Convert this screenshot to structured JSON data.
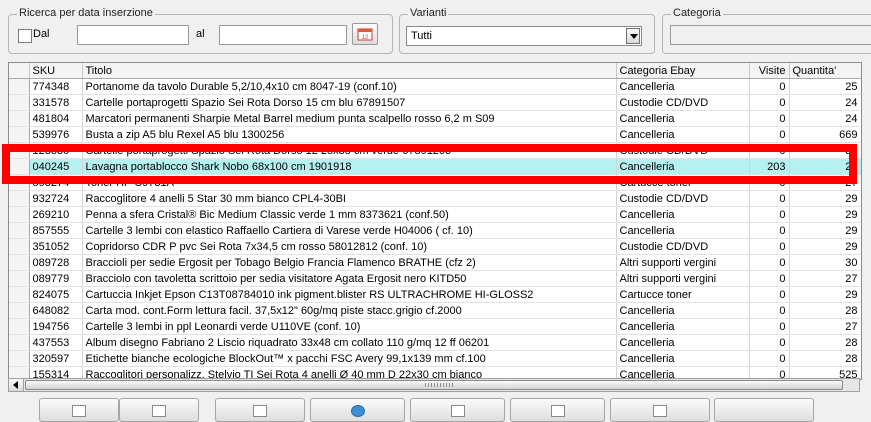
{
  "filters": {
    "date_group": {
      "title": "Ricerca per data inserzione",
      "from_label": "Dal",
      "from_value": "",
      "to_label": "al",
      "to_value": "",
      "calendar_icon": "calendar-icon"
    },
    "variants_group": {
      "title": "Varianti",
      "selected": "Tutti"
    },
    "category_group": {
      "title": "Categoria",
      "value": ""
    }
  },
  "table": {
    "columns": [
      "SKU",
      "Titolo",
      "Categoria Ebay",
      "Visite",
      "Quantita'"
    ],
    "rows": [
      {
        "sku": "774348",
        "title": "Portanome da tavolo Durable 5,2/10,4x10 cm 8047-19 (conf.10)",
        "category": "Cancelleria",
        "visits": "0",
        "qty": "25"
      },
      {
        "sku": "331578",
        "title": "Cartelle portaprogetti Spazio Sei Rota Dorso 15 cm blu 67891507",
        "category": "Custodie CD/DVD",
        "visits": "0",
        "qty": "24"
      },
      {
        "sku": "481804",
        "title": "Marcatori permanenti Sharpie Metal Barrel medium punta scalpello rosso 6,2 m S09",
        "category": "Cancelleria",
        "visits": "0",
        "qty": "24"
      },
      {
        "sku": "539976",
        "title": "Busta a zip A5 blu Rexel A5 blu 1300256",
        "category": "Cancelleria",
        "visits": "0",
        "qty": "669"
      },
      {
        "sku": "123330",
        "title": "Cartelle portaprogetti Spazio Sei Rota Dorso 12 25x35 cm verde 67891203",
        "category": "Custodie CD/DVD",
        "visits": "0",
        "qty": "31"
      },
      {
        "sku": "040245",
        "title": "Lavagna portablocco Shark Nobo 68x100 cm 1901918",
        "category": "Cancelleria",
        "visits": "203",
        "qty": "27",
        "selected": true
      },
      {
        "sku": "598274",
        "title": "Toner HP C9731A",
        "category": "Cartucce toner",
        "visits": "0",
        "qty": "27"
      },
      {
        "sku": "932724",
        "title": "Raccoglitore 4 anelli 5 Star 30 mm bianco CPL4-30BI",
        "category": "Custodie CD/DVD",
        "visits": "0",
        "qty": "29"
      },
      {
        "sku": "269210",
        "title": "Penna a sfera Cristal® Bic Medium Classic verde 1 mm 8373621 (conf.50)",
        "category": "Cancelleria",
        "visits": "0",
        "qty": "29"
      },
      {
        "sku": "857555",
        "title": "Cartelle 3 lembi con elastico Raffaello Cartiera di Varese verde H04006 ( cf. 10)",
        "category": "Cancelleria",
        "visits": "0",
        "qty": "29"
      },
      {
        "sku": "351052",
        "title": "Copridorso CDR P pvc Sei Rota 7x34,5 cm rosso 58012812 (conf. 10)",
        "category": "Custodie CD/DVD",
        "visits": "0",
        "qty": "29"
      },
      {
        "sku": "089728",
        "title": "Braccioli per sedie Ergosit per Tobago Belgio Francia Flamenco BRATHE (cfz 2)",
        "category": "Altri supporti vergini",
        "visits": "0",
        "qty": "30"
      },
      {
        "sku": "089779",
        "title": "Bracciolo con tavoletta scrittoio per sedia visitatore Agata Ergosit nero KITD50",
        "category": "Altri supporti vergini",
        "visits": "0",
        "qty": "27"
      },
      {
        "sku": "824075",
        "title": "Cartuccia Inkjet Epson C13T08784010 ink pigment.blister RS ULTRACHROME HI-GLOSS2",
        "category": "Cartucce toner",
        "visits": "0",
        "qty": "29"
      },
      {
        "sku": "648082",
        "title": "Carta mod. cont.Form lettura facil. 37,5x12\" 60g/mq piste stacc.grigio cf.2000",
        "category": "Cancelleria",
        "visits": "0",
        "qty": "28"
      },
      {
        "sku": "194756",
        "title": "Cartelle 3 lembi in ppl Leonardi verde U110VE (conf. 10)",
        "category": "Cancelleria",
        "visits": "0",
        "qty": "27"
      },
      {
        "sku": "437553",
        "title": "Album disegno Fabriano 2 Liscio riquadrato 33x48 cm collato 110 g/mq 12 ff 06201",
        "category": "Cancelleria",
        "visits": "0",
        "qty": "28"
      },
      {
        "sku": "320597",
        "title": "Etichette bianche ecologiche BlockOut™ x pacchi FSC Avery 99,1x139 mm cf.100",
        "category": "Cancelleria",
        "visits": "0",
        "qty": "28"
      },
      {
        "sku": "155314",
        "title": "Raccoglitori personalizz. Stelvio TI Sei Rota 4 anelli Ø 40 mm D 22x30 cm bianco",
        "category": "Cancelleria",
        "visits": "0",
        "qty": "525"
      }
    ]
  },
  "highlight_color": "#ff0000",
  "selection_color": "#b6f0f0"
}
